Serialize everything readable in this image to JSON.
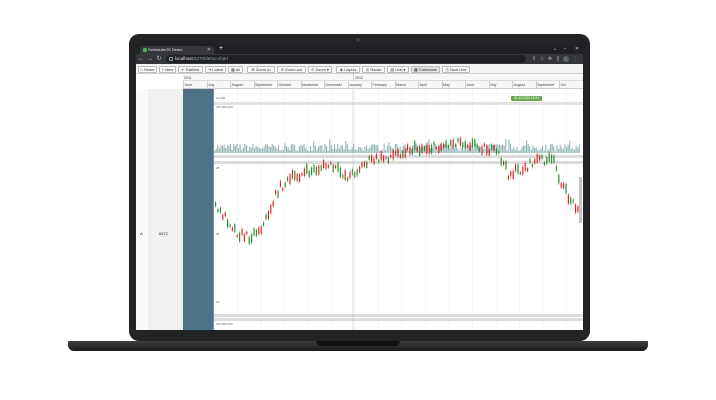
{
  "browser": {
    "tab_title": "SchedulerJS Demo",
    "url_host": "localhost",
    "url_path": ":6270/demo-chart"
  },
  "toolbar": {
    "home": "Home",
    "new": "New",
    "earliest": "Earliest",
    "latest": "Latest",
    "all": "All",
    "zoom_in": "Zoom-in",
    "zoom_out": "Zoom-out",
    "zoom": "Zoom",
    "layers": "Layers",
    "radar": "Radar",
    "unit": "Unit",
    "calendars": "Calendars",
    "now_line": "Now Line"
  },
  "timeline": {
    "years": [
      "2011",
      "2012"
    ],
    "months": [
      "June",
      "July",
      "August",
      "September",
      "October",
      "November",
      "December",
      "January",
      "February",
      "March",
      "April",
      "May",
      "June",
      "July",
      "August",
      "September",
      "Oct"
    ],
    "tooltip": "01.12.2012 15:31"
  },
  "left_panel": {
    "row_id": "A",
    "symbol": "INTC"
  },
  "panes": {
    "top_axis_high": "10.000",
    "top_axis_max": "200,000,000",
    "price_axis_high": "28",
    "price_axis_mid": "24",
    "price_axis_low": "20",
    "bottom_axis_max": "200,000,000",
    "bottom_axis_low": "0"
  },
  "colors": {
    "up": "#2e8b2e",
    "down": "#d42a2a",
    "volume": "#8fb5b3",
    "highlight": "#4e7286",
    "tooltip_bg": "#6aa84f"
  }
}
